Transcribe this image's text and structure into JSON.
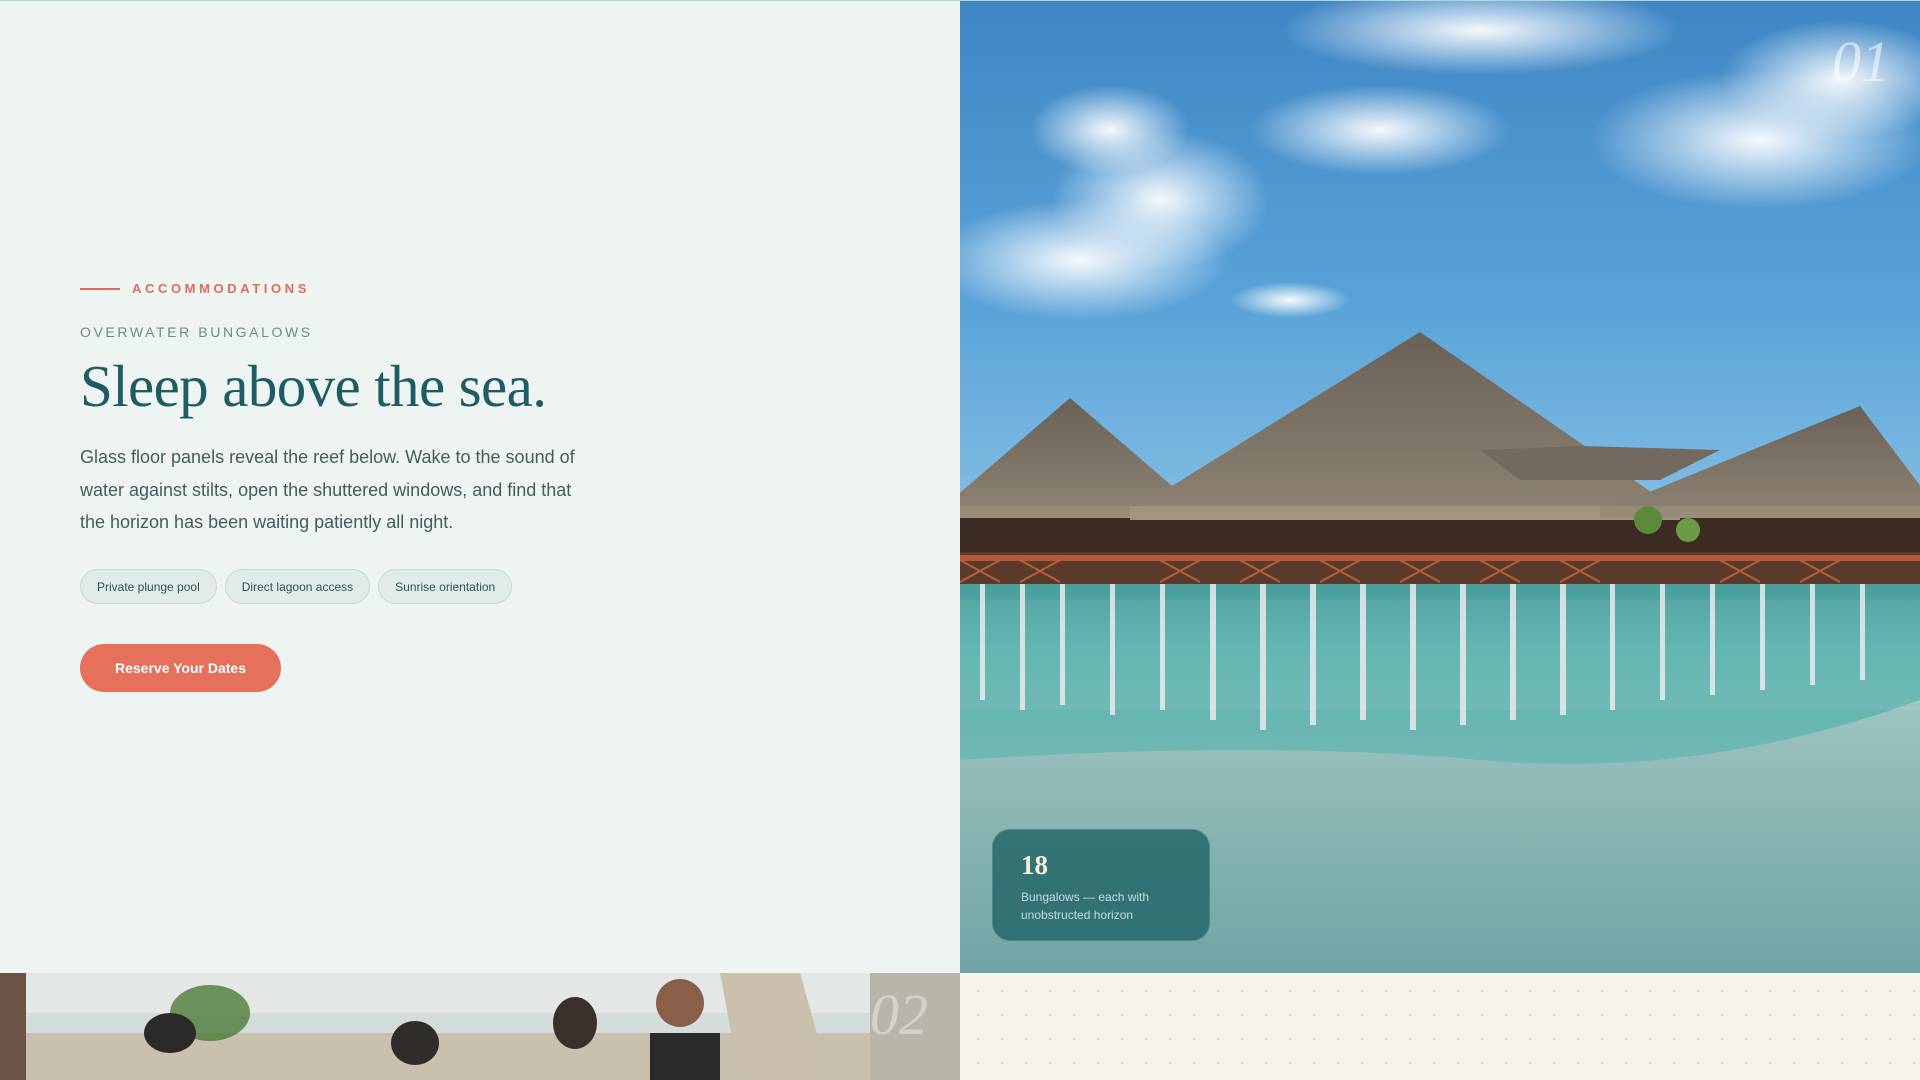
{
  "section_1": {
    "eyebrow": "ACCOMMODATIONS",
    "kicker": "OVERWATER BUNGALOWS",
    "headline": "Sleep above the sea.",
    "body": "Glass floor panels reveal the reef below. Wake to the sound of water against stilts, open the shuttered windows, and find that the horizon has been waiting patiently all night.",
    "features": [
      "Private plunge pool",
      "Direct lagoon access",
      "Sunrise orientation"
    ],
    "cta_label": "Reserve Your Dates",
    "slide_index": "01",
    "stat": {
      "number": "18",
      "caption": "Bungalows — each with unobstructed horizon"
    }
  },
  "section_2": {
    "slide_index": "02"
  },
  "colors": {
    "accent": "#e5705b",
    "brand_teal": "#1e5b62",
    "page_background": "#eef4f2",
    "chip_background": "#e1ecea",
    "stat_card": "#1e6264",
    "alt_background": "#f6f2ec"
  }
}
